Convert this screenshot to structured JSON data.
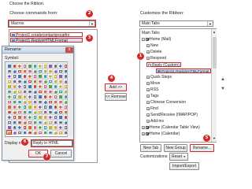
{
  "left_panel": {
    "title": "Choose the Ribbon.",
    "choose_label": "Choose commands from:",
    "choose_value": "Macros",
    "macros": [
      "Project1.createcontactgroupfro",
      "Project1.ReplyinHTMLFormat"
    ]
  },
  "center": {
    "add_button": "Add >>",
    "remove_button": "<< Remove"
  },
  "rename_dialog": {
    "title": "Rename",
    "symbol_label": "Symbol:",
    "display_name_label": "Display name:",
    "display_name_value": "Reply in HTML",
    "ok_button": "OK",
    "cancel_button": "Cancel",
    "close_glyph": "x"
  },
  "right_panel": {
    "title": "Customize the Ribbon:",
    "tabs_value": "Main Tabs",
    "tree_header": "Main Tabs",
    "tree": [
      {
        "label": "Home (Mail)",
        "checked": true
      },
      {
        "label": "New"
      },
      {
        "label": "Delete"
      },
      {
        "label": "Respond"
      },
      {
        "label": "Reply (Custom)"
      },
      {
        "label": "Project1.ReplyinHTMLFormat"
      },
      {
        "label": "Quick Steps"
      },
      {
        "label": "Move"
      },
      {
        "label": "RSS"
      },
      {
        "label": "Tags"
      },
      {
        "label": "Chinese Conversion"
      },
      {
        "label": "Find"
      },
      {
        "label": "Send/Receive (IMAP/POP)"
      },
      {
        "label": "Add-ins"
      },
      {
        "label": "Home (Calendar Table View)",
        "checked": true
      },
      {
        "label": "Home (Calendar)",
        "checked": true
      }
    ],
    "new_tab_button": "New Tab",
    "new_group_button": "New Group",
    "rename_button": "Rename...",
    "customizations_label": "Customizations:",
    "reset_button": "Reset",
    "import_export_button": "Import/Export",
    "scroll_up": "▲",
    "scroll_down": "▼",
    "move_up": "▲",
    "move_down": "▼"
  },
  "step_badges": [
    "1",
    "2",
    "3",
    "4",
    "5",
    "6",
    "7"
  ],
  "accent_red": "#d62828",
  "highlight_blue": "#cce4f7"
}
